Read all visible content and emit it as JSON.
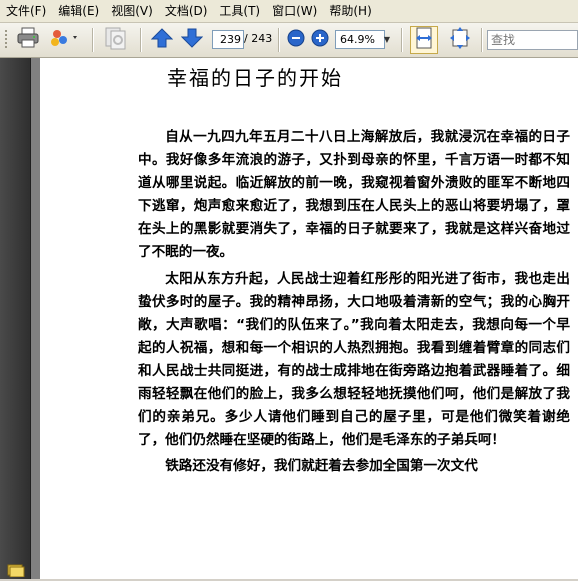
{
  "menubar": {
    "items": [
      {
        "label": "文件(F)"
      },
      {
        "label": "编辑(E)"
      },
      {
        "label": "视图(V)"
      },
      {
        "label": "文档(D)"
      },
      {
        "label": "工具(T)"
      },
      {
        "label": "窗口(W)"
      },
      {
        "label": "帮助(H)"
      }
    ]
  },
  "toolbar": {
    "icons": [
      "print-icon",
      "share-icon",
      "page-nav-icon",
      "prev-page-icon",
      "next-page-icon",
      "zoom-out-icon",
      "zoom-in-icon",
      "fit-width-icon",
      "fit-page-icon"
    ],
    "page_current": "239",
    "page_total": "/ 243",
    "zoom_value": "64.9%",
    "search_placeholder": "查找"
  },
  "colors": {
    "arrow_blue": "#2f6fd6",
    "zoom_blue": "#2a66c9"
  },
  "document": {
    "title": "幸福的日子的开始",
    "paragraphs": [
      "自从一九四九年五月二十八日上海解放后，我就浸沉在幸福的日子中。我好像多年流浪的游子，又扑到母亲的怀里，千言万语一时都不知道从哪里说起。临近解放的前一晚，我窥视着窗外溃败的匪军不断地四下逃窜，炮声愈来愈近了，我想到压在人民头上的恶山将要坍塌了，罩在头上的黑影就要消失了，幸福的日子就要来了，我就是这样兴奋地过了不眠的一夜。",
      "太阳从东方升起，人民战士迎着红彤彤的阳光进了街市，我也走出蛰伏多时的屋子。我的精神昂扬，大口地吸着清新的空气；我的心胸开敞，大声歌唱：“我们的队伍来了。”我向着太阳走去，我想向每一个早起的人祝福，想和每一个相识的人热烈拥抱。我看到缠着臂章的同志们和人民战士共同挺进，有的战士成排地在街旁路边抱着武器睡着了。细雨轻轻飘在他们的脸上，我多么想轻轻地抚摸他们呵，他们是解放了我们的亲弟兄。多少人请他们睡到自己的屋子里，可是他们微笑着谢绝了，他们仍然睡在坚硬的街路上，他们是毛泽东的子弟兵呵！",
      "铁路还没有修好，我们就赶着去参加全国第一次文代"
    ]
  }
}
